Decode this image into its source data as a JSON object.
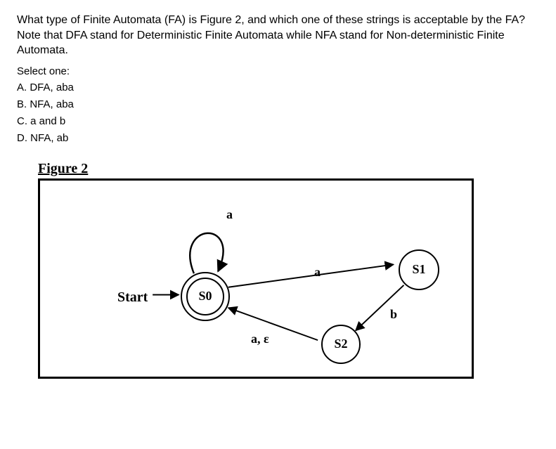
{
  "question": "What type of Finite Automata (FA) is Figure 2, and which one of these strings is acceptable by the FA? Note that DFA stand for Deterministic Finite Automata while NFA stand for Non-deterministic Finite Automata.",
  "select_one": "Select one:",
  "options": {
    "a": "A. DFA, aba",
    "b": "B. NFA, aba",
    "c": "C. a and b",
    "d": "D. NFA, ab"
  },
  "figure": {
    "title": "Figure 2",
    "start_label": "Start",
    "states": {
      "s0": "S0",
      "s1": "S1",
      "s2": "S2"
    },
    "edge_labels": {
      "self_a": "a",
      "s0_s1": "a",
      "s1_s2": "b",
      "s2_s0": "a, ε"
    }
  }
}
